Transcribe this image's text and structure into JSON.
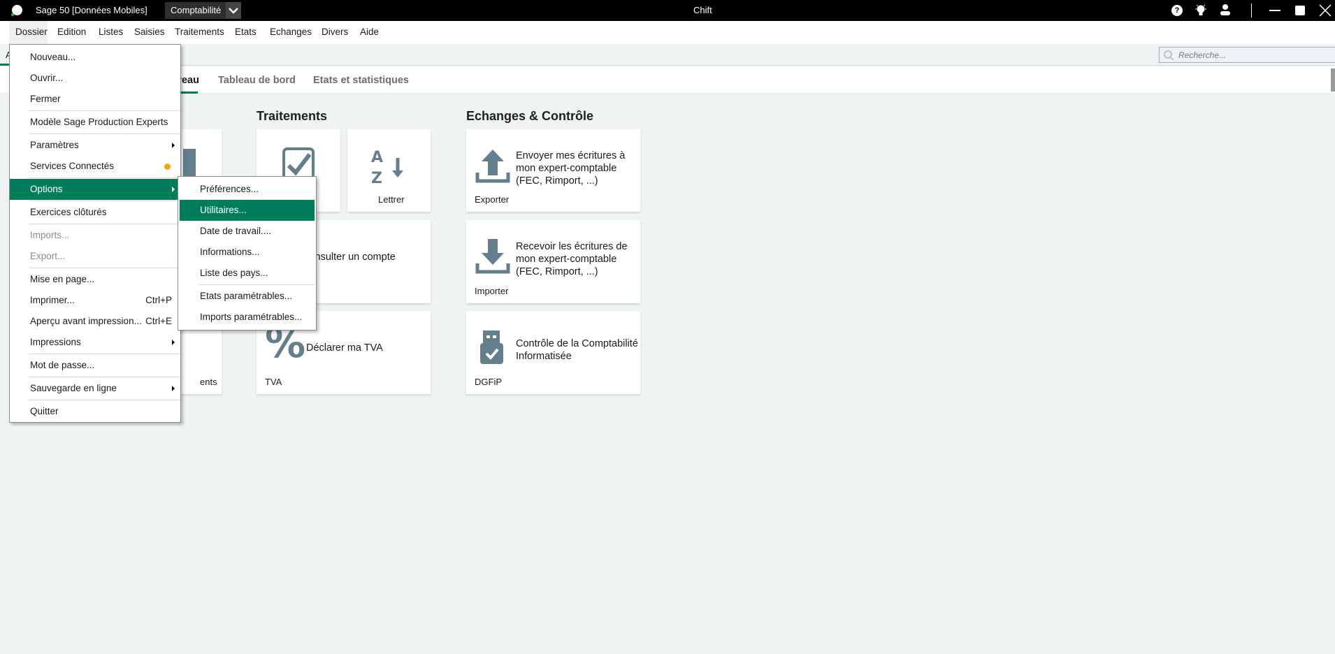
{
  "titlebar": {
    "app_title": "Sage 50 [Données Mobiles]",
    "module": "Comptabilité",
    "center_title": "Chift"
  },
  "menubar": [
    "Dossier",
    "Edition",
    "Listes",
    "Saisies",
    "Traitements",
    "Etats",
    "Echanges",
    "Divers",
    "Aide"
  ],
  "toolband": {
    "tab_fragment": "A",
    "search_placeholder": "Recherche..."
  },
  "tabs": [
    "Bureau",
    "Tableau de bord",
    "Etats et statistiques"
  ],
  "sections": {
    "traitements": {
      "title": "Traitements",
      "lettrer": "Lettrer",
      "consulter": "Consulter un compte",
      "tva_text": "Déclarer ma TVA",
      "tva_label": "TVA"
    },
    "echanges": {
      "title": "Echanges & Contrôle",
      "exporter_text": "Envoyer mes écritures à mon expert-comptable (FEC, Rimport, ...)",
      "exporter_label": "Exporter",
      "importer_text": "Recevoir les écritures de mon expert-comptable (FEC, Rimport, ...)",
      "importer_label": "Importer",
      "dgfip_text": "Contrôle de la Comptabilité Informatisée",
      "dgfip_label": "DGFiP"
    },
    "left": {
      "label_fragment": "ents"
    }
  },
  "dossier_menu": {
    "items": [
      {
        "label": "Nouveau..."
      },
      {
        "label": "Ouvrir..."
      },
      {
        "label": "Fermer"
      },
      {
        "label": "Modèle Sage Production Experts"
      },
      {
        "label": "Paramètres"
      },
      {
        "label": "Services Connectés"
      },
      {
        "label": "Options"
      },
      {
        "label": "Exercices clôturés"
      },
      {
        "label": "Imports..."
      },
      {
        "label": "Export..."
      },
      {
        "label": "Mise en page..."
      },
      {
        "label": "Imprimer...",
        "shortcut": "Ctrl+P"
      },
      {
        "label": "Aperçu avant impression...",
        "shortcut": "Ctrl+E"
      },
      {
        "label": "Impressions"
      },
      {
        "label": "Mot de passe..."
      },
      {
        "label": "Sauvegarde en ligne"
      },
      {
        "label": "Quitter"
      }
    ]
  },
  "options_submenu": {
    "items": [
      {
        "label": "Préférences..."
      },
      {
        "label": "Utilitaires..."
      },
      {
        "label": "Date de travail...."
      },
      {
        "label": "Informations..."
      },
      {
        "label": "Liste des pays..."
      },
      {
        "label": "Etats paramétrables..."
      },
      {
        "label": "Imports paramétrables..."
      }
    ]
  },
  "colors": {
    "accent": "#007e5c",
    "icon": "#647f8c",
    "status_dot": "#f5a800"
  }
}
